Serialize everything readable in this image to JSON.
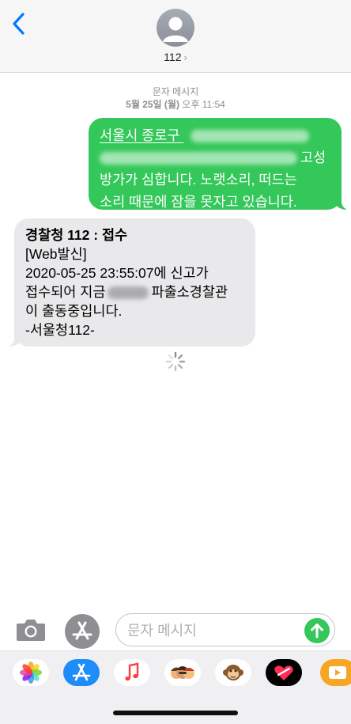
{
  "header": {
    "contact_name": "112",
    "chevron": "›"
  },
  "meta": {
    "label": "문자 메시지",
    "date": "5월 25일 (월)",
    "time": "오후 11:54"
  },
  "messages": {
    "outgoing": {
      "line1": "서울시 종로구",
      "line2_visible": "고성",
      "line3": "방가가 심합니다. 노랫소리, 떠드는",
      "line4": "소리 때문에 잠을 못자고 있습니다."
    },
    "incoming": {
      "title": "경찰청 112 : 접수",
      "line2": "[Web발신]",
      "line3": "2020-05-25 23:55:07에 신고가",
      "line4_a": "접수되어 지금",
      "line4_b": "파출소경찰관",
      "line5": "이 출동중입니다.",
      "line6": "-서울청112-"
    }
  },
  "composer": {
    "placeholder": "문자 메시지"
  },
  "icons": {
    "back": "chevron-left-icon",
    "camera": "camera-icon",
    "apps": "app-store-icon",
    "send": "arrow-up-icon",
    "tray": [
      "photos-icon",
      "app-store-icon",
      "music-icon",
      "memoji-icon",
      "monkey-animoji-icon",
      "digital-touch-icon",
      "video-app-icon"
    ]
  },
  "colors": {
    "accent_blue": "#007aff",
    "sms_green": "#34c759",
    "incoming_gray": "#e9e9eb"
  }
}
